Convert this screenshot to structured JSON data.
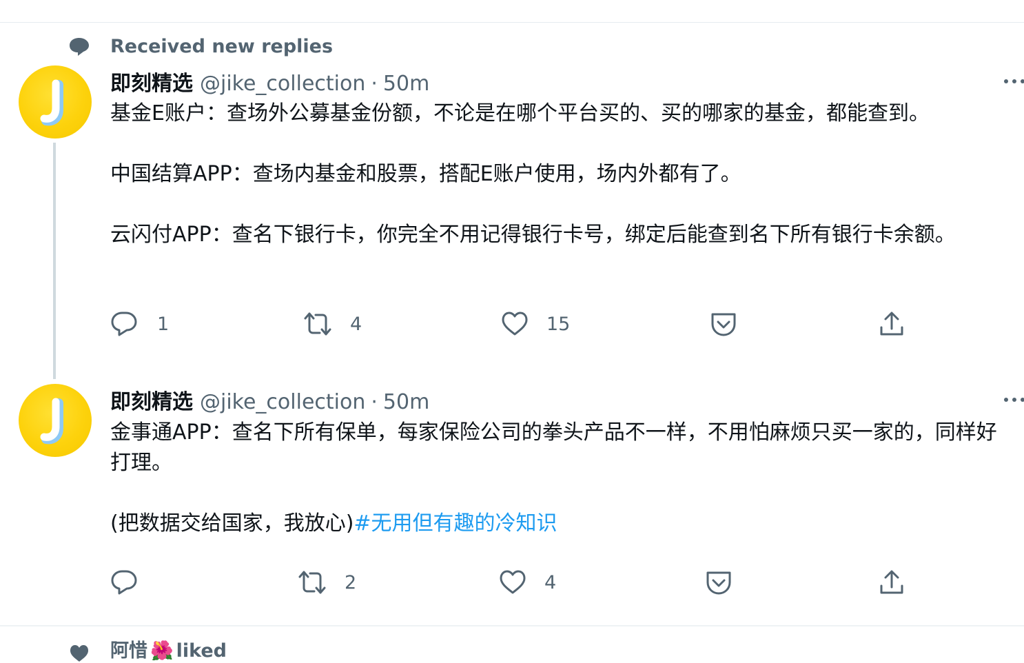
{
  "context": {
    "top_label": "Received new replies",
    "bottom_label_name": "阿惜",
    "bottom_label_emoji": "🌺",
    "bottom_label_action": "liked"
  },
  "tweets": [
    {
      "author": {
        "name": "即刻精选",
        "handle": "@jike_collection",
        "time": "50m",
        "avatar_letter": "J"
      },
      "paragraphs": [
        "基金E账户：查场外公募基金份额，不论是在哪个平台买的、买的哪家的基金，都能查到。",
        "中国结算APP：查场内基金和股票，搭配E账户使用，场内外都有了。",
        "云闪付APP：查名下银行卡，你完全不用记得银行卡号，绑定后能查到名下所有银行卡余额。"
      ],
      "counts": {
        "replies": "1",
        "retweets": "4",
        "likes": "15"
      }
    },
    {
      "author": {
        "name": "即刻精选",
        "handle": "@jike_collection",
        "time": "50m",
        "avatar_letter": "J"
      },
      "paragraphs": [
        "金事通APP：查名下所有保单，每家保险公司的拳头产品不一样，不用怕麻烦只买一家的，同样好打理。",
        "(把数据交给国家，我放心)"
      ],
      "hashtag": "#无用但有趣的冷知识",
      "counts": {
        "replies": "",
        "retweets": "2",
        "likes": "4"
      }
    }
  ],
  "separator": "·",
  "icons": [
    "speech-bubble-icon",
    "reply-icon",
    "retweet-icon",
    "like-icon",
    "save-icon",
    "share-icon",
    "more-icon",
    "heart-flower-icon"
  ],
  "colors": {
    "text": "#0f1419",
    "secondary": "#536471",
    "accent": "#1d9bf0",
    "avatar": "#fdd20c",
    "thread_line": "#cfd9de"
  }
}
